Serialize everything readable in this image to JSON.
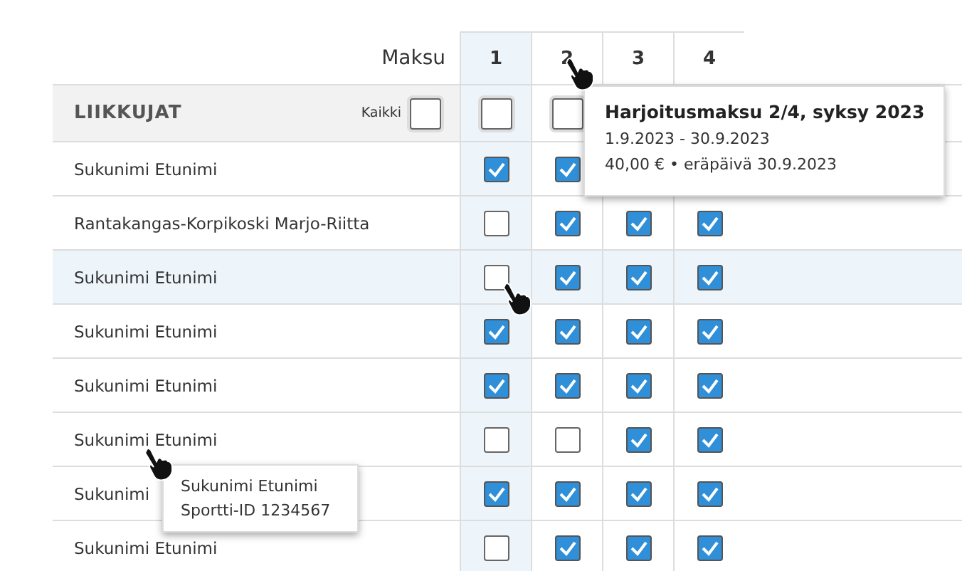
{
  "header": {
    "label": "Maksu",
    "columns": [
      {
        "label": "1",
        "selected": true
      },
      {
        "label": "2",
        "selected": false
      },
      {
        "label": "3",
        "selected": false
      },
      {
        "label": "4",
        "selected": false
      }
    ]
  },
  "group": {
    "title": "LIIKKUJAT",
    "all_label": "Kaikki",
    "all_checked": false,
    "column_checks": [
      false,
      false
    ]
  },
  "rows": [
    {
      "name": "Sukunimi Etunimi",
      "selected": false,
      "checks": [
        true,
        true
      ]
    },
    {
      "name": "Rantakangas-Korpikoski Marjo-Riitta",
      "selected": false,
      "checks": [
        false,
        true,
        true,
        true
      ]
    },
    {
      "name": "Sukunimi Etunimi",
      "selected": true,
      "checks": [
        false,
        true,
        true,
        true
      ]
    },
    {
      "name": "Sukunimi Etunimi",
      "selected": false,
      "checks": [
        true,
        true,
        true,
        true
      ]
    },
    {
      "name": "Sukunimi Etunimi",
      "selected": false,
      "checks": [
        true,
        true,
        true,
        true
      ]
    },
    {
      "name": "Sukunimi Etunimi",
      "selected": false,
      "checks": [
        false,
        false,
        true,
        true
      ]
    },
    {
      "name": "Sukunimi",
      "selected": false,
      "checks": [
        true,
        true,
        true,
        true
      ]
    },
    {
      "name": "Sukunimi Etunimi",
      "selected": false,
      "checks": [
        false,
        true,
        true,
        true
      ]
    }
  ],
  "payment_tooltip": {
    "title": "Harjoitusmaksu 2/4, syksy 2023",
    "dates": "1.9.2023 - 30.9.2023",
    "amount": "40,00 € • eräpäivä 30.9.2023"
  },
  "person_tooltip": {
    "name": "Sukunimi Etunimi",
    "id": "Sportti-ID 1234567"
  }
}
